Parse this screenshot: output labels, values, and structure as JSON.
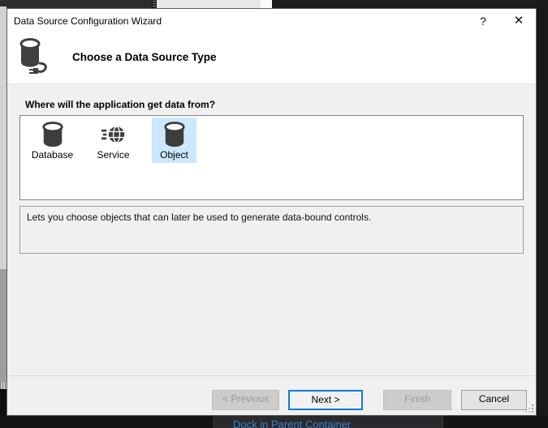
{
  "window": {
    "title": "Data Source Configuration Wizard",
    "help_glyph": "?",
    "close_glyph": "✕"
  },
  "header": {
    "title": "Choose a Data Source Type",
    "icon": "database-plug-icon"
  },
  "main": {
    "question": "Where will the application get data from?",
    "sources": [
      {
        "label": "Database",
        "icon": "database-icon",
        "selected": false
      },
      {
        "label": "Service",
        "icon": "service-globe-icon",
        "selected": false
      },
      {
        "label": "Object",
        "icon": "object-database-icon",
        "selected": true
      }
    ],
    "description": "Lets you choose objects that can later be used to generate data-bound controls."
  },
  "footer": {
    "previous_label": "< Previous",
    "next_label": "Next >",
    "finish_label": "Finish",
    "cancel_label": "Cancel"
  },
  "background": {
    "context_menu_item": "Dock in Parent Container"
  },
  "colors": {
    "selection_bg": "#cbe8fc",
    "accent_border": "#0f7ad3",
    "menu_link_blue": "#3c80c4",
    "icon_gray": "#3d3d3d"
  }
}
